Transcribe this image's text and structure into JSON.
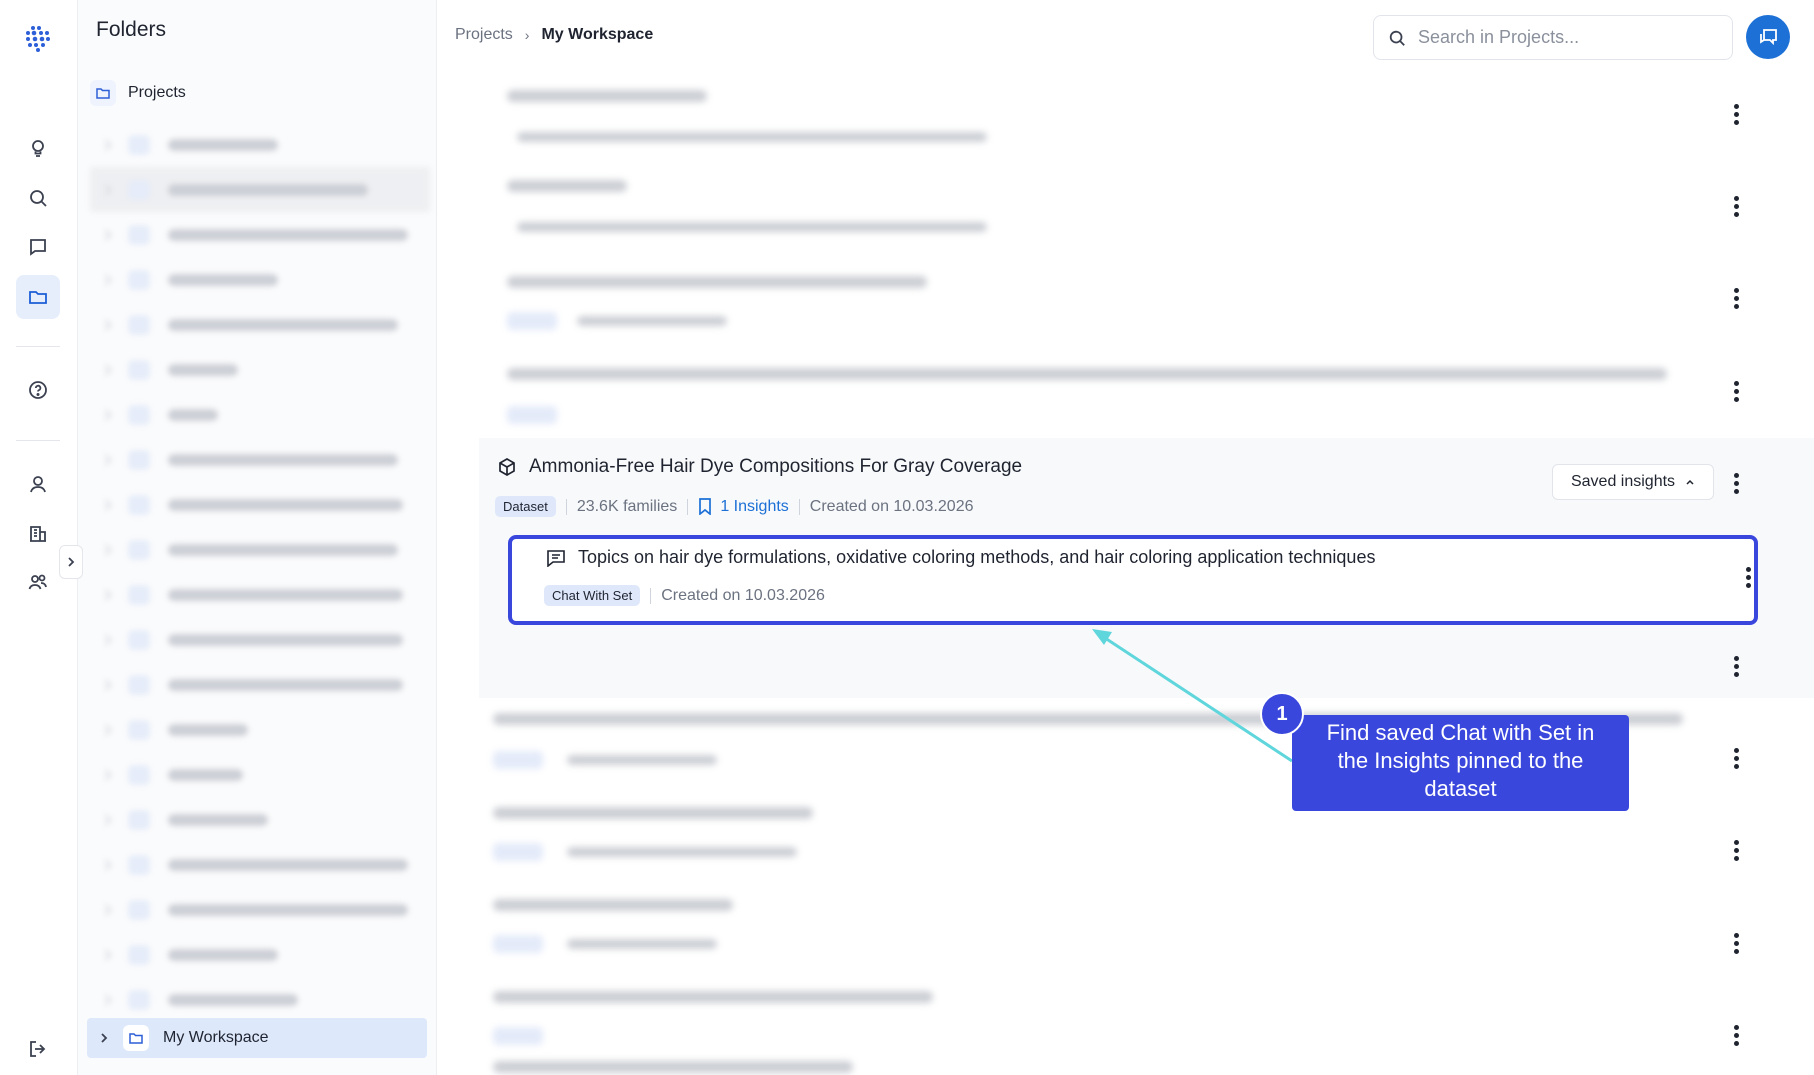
{
  "rail": {
    "icons": [
      "logo-icon",
      "lightbulb-icon",
      "search-icon",
      "chat-icon",
      "folder-icon",
      "help-icon",
      "user-icon",
      "building-icon",
      "team-icon",
      "logout-icon"
    ]
  },
  "folders": {
    "title": "Folders",
    "root_label": "Projects",
    "selected_label": "My Workspace"
  },
  "header": {
    "breadcrumb_root": "Projects",
    "breadcrumb_current": "My Workspace",
    "search_placeholder": "Search in Projects..."
  },
  "dataset": {
    "title": "Ammonia-Free Hair Dye Compositions For Gray Coverage",
    "badge": "Dataset",
    "families": "23.6K families",
    "insights": "1 Insights",
    "created": "Created on 10.03.2026",
    "saved_button": "Saved insights"
  },
  "insight": {
    "title": "Topics on hair dye formulations, oxidative coloring methods, and hair coloring application techniques",
    "badge": "Chat With Set",
    "created": "Created on 10.03.2026"
  },
  "callout": {
    "step": "1",
    "text": "Find saved Chat with Set in the Insights pinned to the dataset"
  },
  "colors": {
    "accent": "#3a47dd",
    "link": "#1c70d6",
    "arrow": "#5fd6dc"
  }
}
